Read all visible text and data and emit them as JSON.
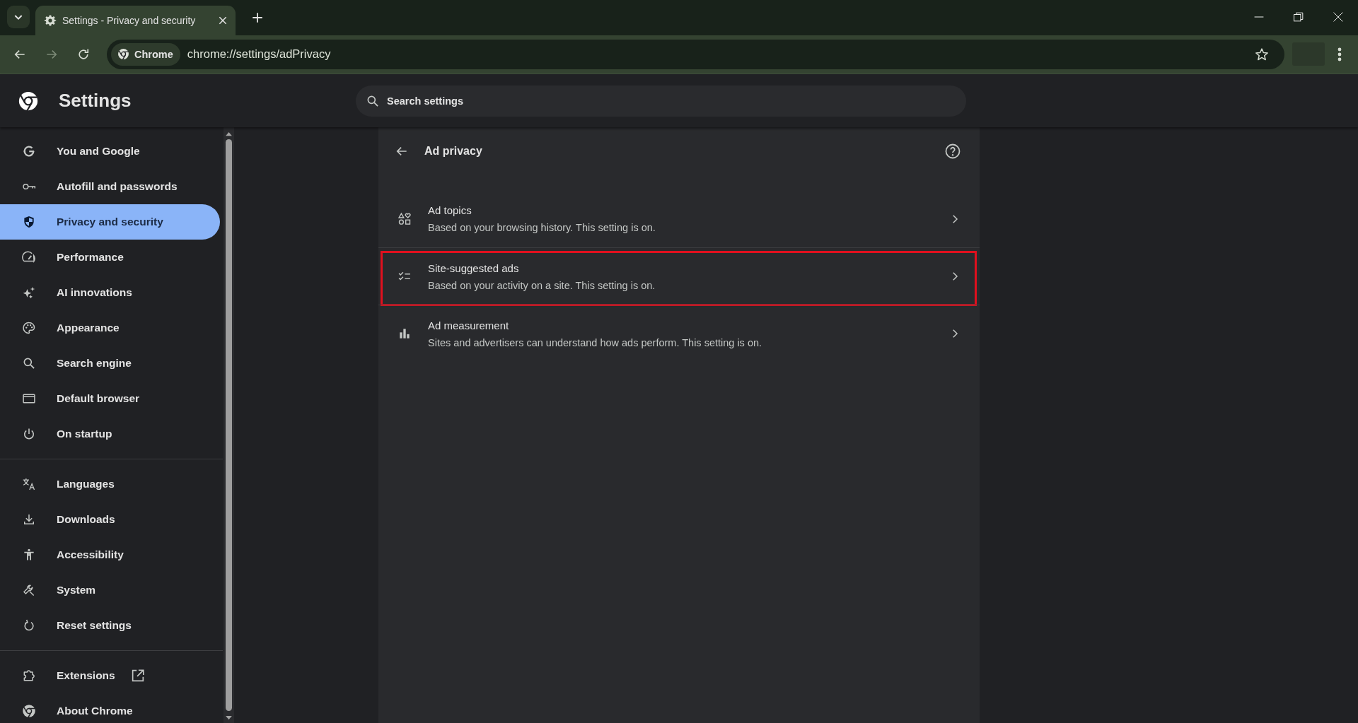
{
  "browser": {
    "tabs": [
      {
        "title": "Settings - Privacy and security",
        "selected": true
      }
    ],
    "omnibox": {
      "chip": "Chrome",
      "url": "chrome://settings/adPrivacy"
    }
  },
  "header": {
    "title": "Settings",
    "search": {
      "placeholder": "Search settings"
    }
  },
  "sidebar": {
    "sections": [
      {
        "items": [
          {
            "label": "You and Google",
            "selected": false,
            "external": false
          },
          {
            "label": "Autofill and passwords",
            "selected": false,
            "external": false
          },
          {
            "label": "Privacy and security",
            "selected": true,
            "external": false
          },
          {
            "label": "Performance",
            "selected": false,
            "external": false
          },
          {
            "label": "AI innovations",
            "selected": false,
            "external": false
          },
          {
            "label": "Appearance",
            "selected": false,
            "external": false
          },
          {
            "label": "Search engine",
            "selected": false,
            "external": false
          },
          {
            "label": "Default browser",
            "selected": false,
            "external": false
          },
          {
            "label": "On startup",
            "selected": false,
            "external": false
          }
        ]
      },
      {
        "items": [
          {
            "label": "Languages",
            "selected": false,
            "external": false
          },
          {
            "label": "Downloads",
            "selected": false,
            "external": false
          },
          {
            "label": "Accessibility",
            "selected": false,
            "external": false
          },
          {
            "label": "System",
            "selected": false,
            "external": false
          },
          {
            "label": "Reset settings",
            "selected": false,
            "external": false
          }
        ]
      },
      {
        "items": [
          {
            "label": "Extensions",
            "selected": false,
            "external": true
          },
          {
            "label": "About Chrome",
            "selected": false,
            "external": false
          }
        ]
      }
    ]
  },
  "page": {
    "title": "Ad privacy",
    "rows": [
      {
        "title": "Ad topics",
        "description": "Based on your browsing history. This setting is on.",
        "highlighted": false
      },
      {
        "title": "Site-suggested ads",
        "description": "Based on your activity on a site. This setting is on.",
        "highlighted": true
      },
      {
        "title": "Ad measurement",
        "description": "Sites and advertisers can understand how ads perform. This setting is on.",
        "highlighted": false
      }
    ]
  }
}
